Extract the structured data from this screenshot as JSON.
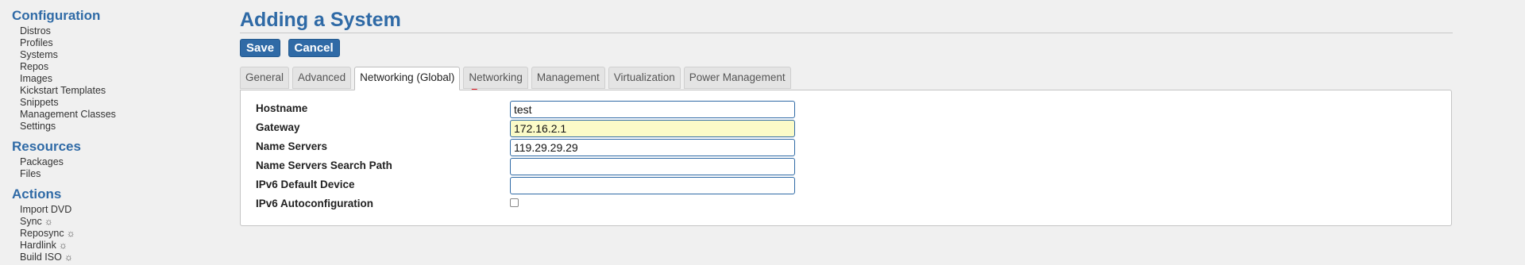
{
  "sidebar": {
    "configuration": {
      "heading": "Configuration",
      "items": [
        "Distros",
        "Profiles",
        "Systems",
        "Repos",
        "Images",
        "Kickstart Templates",
        "Snippets",
        "Management Classes",
        "Settings"
      ]
    },
    "resources": {
      "heading": "Resources",
      "items": [
        "Packages",
        "Files"
      ]
    },
    "actions": {
      "heading": "Actions",
      "items": [
        "Import DVD",
        "Sync",
        "Reposync",
        "Hardlink",
        "Build ISO"
      ],
      "gear_icon": "☼"
    }
  },
  "main": {
    "title": "Adding a System",
    "buttons": {
      "save": "Save",
      "cancel": "Cancel"
    },
    "tabs": [
      "General",
      "Advanced",
      "Networking (Global)",
      "Networking",
      "Management",
      "Virtualization",
      "Power Management"
    ],
    "active_tab": "Networking (Global)",
    "form": {
      "hostname": {
        "label": "Hostname",
        "value": "test"
      },
      "gateway": {
        "label": "Gateway",
        "value": "172.16.2.1"
      },
      "name_servers": {
        "label": "Name Servers",
        "value": "119.29.29.29"
      },
      "name_servers_search": {
        "label": "Name Servers Search Path",
        "value": ""
      },
      "ipv6_default_device": {
        "label": "IPv6 Default Device",
        "value": ""
      },
      "ipv6_autoconfig": {
        "label": "IPv6 Autoconfiguration",
        "checked": false
      }
    }
  },
  "colors": {
    "brand_blue": "#2f6aa6",
    "highlight_yellow": "#fbfbc8",
    "annotation_red": "#e8202a"
  }
}
